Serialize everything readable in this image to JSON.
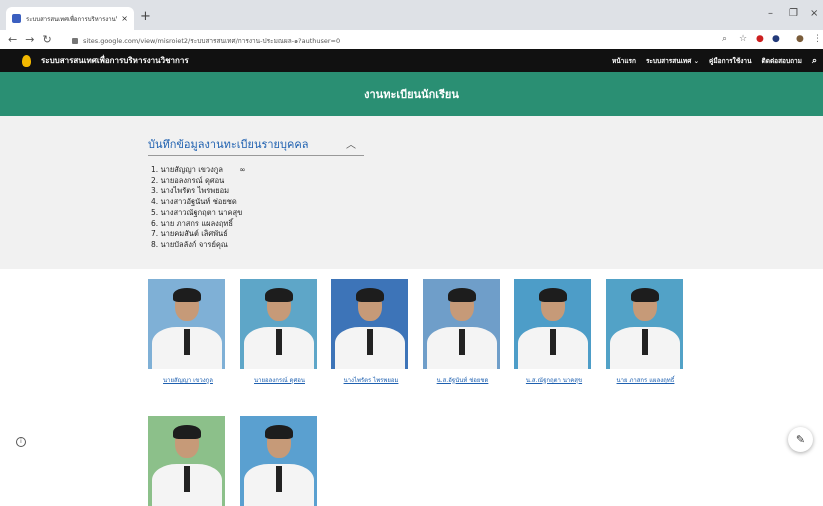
{
  "browser": {
    "tab_title": "ระบบสารสนเทศเพื่อการบริหารงานวิชา",
    "url": "sites.google.com/view/misroiet2/ระบบสารสนเทศ/การงาน-ประมณผล-๑?authuser=0"
  },
  "site": {
    "title": "ระบบสารสนเทศเพื่อการบริหารงานวิชาการ",
    "nav": [
      "หน้าแรก",
      "ระบบสารสนเทศ",
      "คู่มือการใช้งาน",
      "ติดต่อสอบถาม"
    ],
    "banner": "งานทะเบียนนักเรียน"
  },
  "section": {
    "title": "บันทึกข้อมูลงานทะเบียนรายบุคคล",
    "names": [
      "1. นายสัญญา เขวงกูล",
      "2. นายอลงกรณ์ ดุศอน",
      "3. นางไพรัตร ไพรพยอม",
      "4. นางสาวอัฐนันท์ ช่อยชด",
      "5. นางสาวณัฐกฤตา นาคสุข",
      "6. นาย ภาสกร แผลงฤทธิ์",
      "7. นายคมสันต์ เลิศพันธ์",
      "8. นายบัลลังก์ จารย์คุณ"
    ]
  },
  "photos": [
    {
      "caption": "นายสัญญา เขวงกูล",
      "bg": "#7fb0d6"
    },
    {
      "caption": "นายอลงกรณ์ ดุศอน",
      "bg": "#5ea6c8"
    },
    {
      "caption": "นางไพรัตร ไพรพยอม",
      "bg": "#3d74b8"
    },
    {
      "caption": "น.ส.อัฐนันท์ ช่อยชด",
      "bg": "#6f9ec9"
    },
    {
      "caption": "น.ส.ณัฐกฤตา นาคสุข",
      "bg": "#4d9dc8"
    },
    {
      "caption": "นาย ภาสกร แผลงฤทธิ์",
      "bg": "#52a2c7"
    },
    {
      "caption": "",
      "bg": "#8cc08a"
    },
    {
      "caption": "",
      "bg": "#5aa0d0"
    }
  ]
}
